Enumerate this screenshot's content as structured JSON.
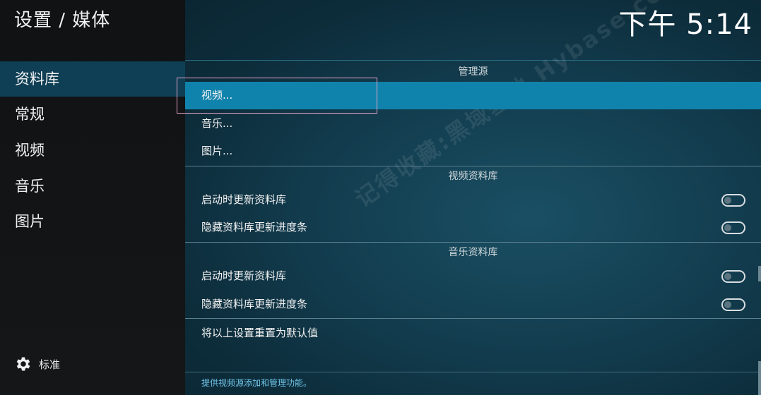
{
  "header": {
    "title": "设置 / 媒体",
    "clock": "下午 5:14"
  },
  "sidebar": {
    "items": [
      {
        "label": "资料库",
        "active": true
      },
      {
        "label": "常规",
        "active": false
      },
      {
        "label": "视频",
        "active": false
      },
      {
        "label": "音乐",
        "active": false
      },
      {
        "label": "图片",
        "active": false
      }
    ],
    "level_label": "标准",
    "level_icon": "gear-icon"
  },
  "main": {
    "sections": [
      {
        "header": "管理源",
        "rows": [
          {
            "label": "视频..."
          },
          {
            "label": "音乐..."
          },
          {
            "label": "图片..."
          }
        ]
      },
      {
        "header": "视频资料库",
        "rows": [
          {
            "label": "启动时更新资料库",
            "toggle": false
          },
          {
            "label": "隐藏资料库更新进度条",
            "toggle": false
          }
        ]
      },
      {
        "header": "音乐资料库",
        "rows": [
          {
            "label": "启动时更新资料库",
            "toggle": false
          },
          {
            "label": "隐藏资料库更新进度条",
            "toggle": false
          }
        ]
      }
    ],
    "reset_label": "将以上设置重置为默认值",
    "hint": "提供视频源添加和管理功能。",
    "watermark": "记得收藏:黑域基地 Hybase.com"
  },
  "colors": {
    "sidebar_bg": "#121416",
    "sidebar_active": "#0f3f55",
    "focus_row": "#1083ac",
    "hint_text": "#6fc3e6"
  }
}
